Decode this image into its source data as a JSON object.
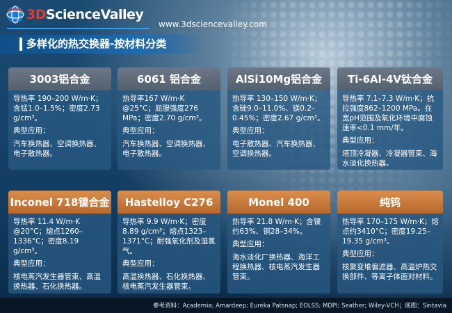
{
  "header": {
    "logo_text_prefix": "3D",
    "logo_text_main": "ScienceValley",
    "site_url": "www.3dsciencevalley.com",
    "title": "多样化的热交换器-按材料分类"
  },
  "colors": {
    "gray_header": "#5f6b79",
    "orange_header": "#c8783b",
    "card_bg": "#285880",
    "accent_blue": "#2a9df4",
    "logo_red": "#e03a2f"
  },
  "cards": [
    {
      "name": "3003铝合金",
      "props": "导热率 190–200 W/m·K；含锰1.0–1.5%；密度2.73 g/cm³。",
      "app_title": "典型应用：",
      "apps": "汽车换热器、空调换热器、电子散热器。"
    },
    {
      "name": "6061 铝合金",
      "props": "热导率167 W/m·K @25°C；屈服强度276 MPa；密度2.70 g/cm³。",
      "app_title": "典型应用：",
      "apps": "汽车换热器、空调换热器、电子散热器。"
    },
    {
      "name": "AlSi10Mg铝合金",
      "props": "热导率 130–150 W/m·K；含硅9.0–11.0%、镁0.2–0.45%；密度2.67 g/cm³。",
      "app_title": "典型应用：",
      "apps": "电子散热器、汽车换热器、空调换热器。"
    },
    {
      "name": "Ti-6Al-4V钛合金",
      "props": "导热率 7.1–7.3 W/m·K；抗拉强度862–1200 MPa。在宽pH范围及氧化环境中腐蚀速率<0.1 mm/年。",
      "app_title": "典型应用：",
      "apps": "塔顶冷凝器、冷凝器管束、海水淡化换热器。"
    },
    {
      "name": "Inconel 718镍合金",
      "props": "导热率 11.4 W/m·K @20°C；熔点1260–1336°C；密度8.19 g/cm³。",
      "app_title": "典型应用：",
      "apps": "核电蒸汽发生器管束、高温换热器、石化换热器。"
    },
    {
      "name": "Hastelloy C276",
      "props": "导热率 9.9 W/m·K；密度8.89 g/cm³；熔点1323–1371°C；耐强氧化剂及湿氯气。",
      "app_title": "典型应用：",
      "apps": "高温换热器、石化换热器、核电蒸汽发生器管束。"
    },
    {
      "name": "Monel 400",
      "props": "热导率 21.8 W/m·K；含镍约63%、铜28–34%。",
      "app_title": "典型应用：",
      "apps": "海水淡化厂换热器、海洋工程换热器、核电蒸汽发生器管束。"
    },
    {
      "name": "纯钨",
      "props": "热导率 170–175 W/m·K；熔点约3410°C；密度19.25–19.35 g/cm³。",
      "app_title": "典型应用：",
      "apps": "核聚变堆偏滤器、高温炉热交换部件、等离子体面对材料。"
    }
  ],
  "footer": {
    "text": "参考资料：Academia; Amardeep; Eureka Patsnap; EOLSS; MDPI; Seather; Wiley-VCH；底图：Sintavia"
  }
}
